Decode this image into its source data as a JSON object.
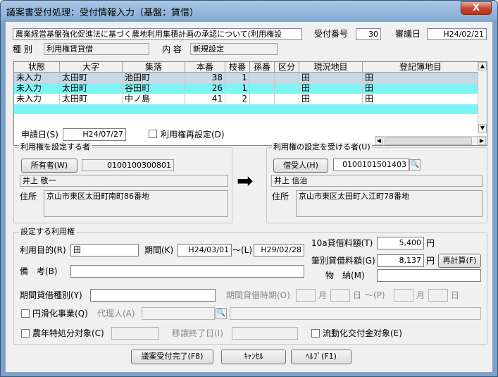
{
  "window": {
    "title": "議案書受付処理：受付情報入力（基盤：賃借）",
    "close_label": "X"
  },
  "header": {
    "agenda": "農業経営基盤強化促進法に基づく農地利用集積計画の承認について(利用権設",
    "receipt_no_label": "受付番号",
    "receipt_no": "30",
    "deliberation_date_label": "審議日",
    "deliberation_date": "H24/02/21",
    "type_label": "種 別",
    "type_value": "利用権賃貸借",
    "content_label": "内 容",
    "content_value": "新規設定"
  },
  "grid": {
    "columns": [
      "状態",
      "大字",
      "集落",
      "本番",
      "枝番",
      "孫番",
      "区分",
      "現況地目",
      "登記簿地目"
    ],
    "rows": [
      {
        "status": "未入力",
        "oaza": "太田町",
        "shuraku": "池田町",
        "honban": "38",
        "edaban": "1",
        "magoban": "",
        "kubun": "",
        "genkyo": "田",
        "toki": "田"
      },
      {
        "status": "未入力",
        "oaza": "太田町",
        "shuraku": "谷田町",
        "honban": "26",
        "edaban": "1",
        "magoban": "",
        "kubun": "",
        "genkyo": "田",
        "toki": "田"
      },
      {
        "status": "未入力",
        "oaza": "太田町",
        "shuraku": "中ノ島",
        "honban": "41",
        "edaban": "2",
        "magoban": "",
        "kubun": "",
        "genkyo": "田",
        "toki": "田"
      }
    ]
  },
  "application": {
    "date_label": "申請日(S)",
    "date_value": "H24/07/27",
    "reset_label": "利用権再設定(D)"
  },
  "grantor": {
    "group_title": "利用権を設定する者",
    "button_label": "所有者(W)",
    "code": "0100100300801",
    "name": "井上 敬一",
    "address_label": "住所",
    "address": "京山市東区太田町南町86番地"
  },
  "grantee": {
    "group_title": "利用権の設定を受ける者(U)",
    "button_label": "借受人(H)",
    "code": "0100101501403",
    "name": "井上 信治",
    "address_label": "住所",
    "address": "京山市東区太田町入江町78番地"
  },
  "arrow": "➡",
  "rights": {
    "group_title": "設定する利用権",
    "purpose_label": "利用目的(R)",
    "purpose_value": "田",
    "period_label": "期間(K)",
    "period_from": "H24/03/01",
    "tilde_label": "〜(L)",
    "period_to": "H29/02/28",
    "rent_10a_label": "10a貸借料額(T)",
    "rent_10a_value": "5,400",
    "rent_10a_unit": "円",
    "rent_each_label": "筆別貸借料額(G)",
    "rent_each_value": "8,137",
    "rent_each_unit": "円",
    "recalc_label": "再計算(F)",
    "note_label": "備　考(B)",
    "note_value": "",
    "goods_label": "物　納(M)",
    "goods_value": "",
    "period_rent_type_label": "期間貸借種別(Y)",
    "period_rent_time_label": "期間貸借時期(O)",
    "month_label": "月",
    "day_label": "日",
    "tilde_p_label": "〜(P)",
    "smooth_label": "円滑化事業(Q)",
    "agent_label": "代理人(A)",
    "annual_label": "農年特処分対象(C)",
    "transfer_end_label": "移譲終了日(I)",
    "fluid_label": "流動化交付金対象(E)"
  },
  "footer": {
    "complete_label": "議案受付完了(F8)",
    "cancel_label": "ｷｬﾝｾﾙ",
    "help_label": "ﾍﾙﾌﾟ(F1)"
  },
  "colors": {
    "selected_row": "#c8d8e4",
    "highlight_row": "#7ff4f4"
  }
}
